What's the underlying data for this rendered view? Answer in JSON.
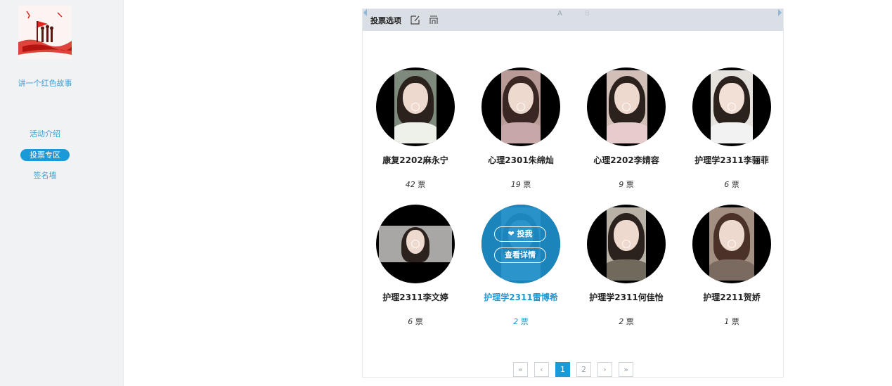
{
  "sidebar": {
    "title": "讲一个红色故事",
    "nav": [
      {
        "label": "活动介绍",
        "active": false
      },
      {
        "label": "投票专区",
        "active": true
      },
      {
        "label": "签名墙",
        "active": false
      }
    ]
  },
  "panel": {
    "toolbar": {
      "title": "投票选项",
      "icons": [
        "edit-icon",
        "layout-icon"
      ],
      "letter_a": "A",
      "letter_b": "B"
    },
    "candidates": [
      {
        "name": "康复2202麻永宁",
        "votes": "42",
        "unit": "票"
      },
      {
        "name": "心理2301朱绵灿",
        "votes": "19",
        "unit": "票"
      },
      {
        "name": "心理2202李婧容",
        "votes": "9",
        "unit": "票"
      },
      {
        "name": "护理学2311李骊菲",
        "votes": "6",
        "unit": "票"
      },
      {
        "name": "护理2311李文婷",
        "votes": "6",
        "unit": "票"
      },
      {
        "name": "护理学2311雷博希",
        "votes": "2",
        "unit": "票"
      },
      {
        "name": "护理学2311何佳怡",
        "votes": "2",
        "unit": "票"
      },
      {
        "name": "护理2211贺娇",
        "votes": "1",
        "unit": "票"
      }
    ],
    "overlay": {
      "vote_label": "投我",
      "details_label": "查看详情"
    },
    "pagination": {
      "first": "«",
      "prev": "‹",
      "pages": [
        "1",
        "2"
      ],
      "current": "1",
      "next": "›",
      "last": "»"
    }
  },
  "colors": {
    "accent": "#1a9ad6",
    "toolbar_bg": "#d9dfe4",
    "sidebar_bg": "#f1f2f3"
  }
}
